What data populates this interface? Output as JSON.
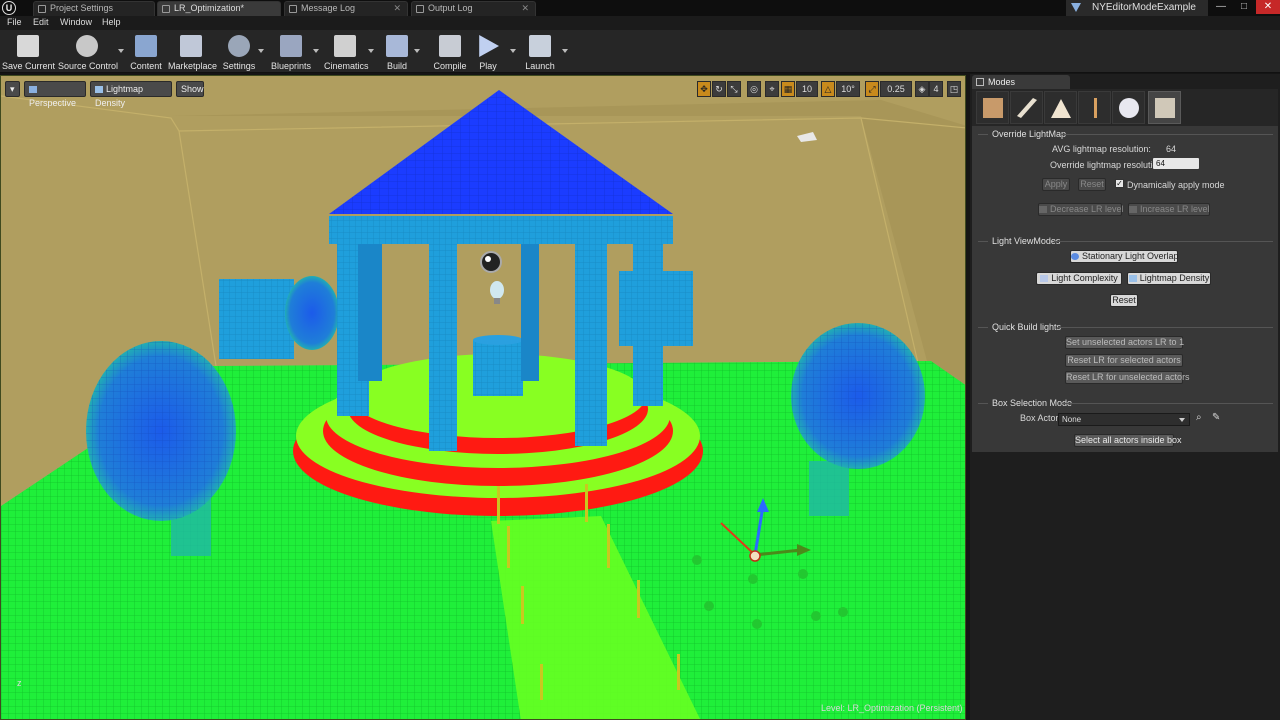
{
  "tabs": [
    {
      "label": "Project Settings"
    },
    {
      "label": "LR_Optimization*"
    },
    {
      "label": "Message Log"
    },
    {
      "label": "Output Log"
    }
  ],
  "project_name": "NYEditorModeExample",
  "menu": [
    "File",
    "Edit",
    "Window",
    "Help"
  ],
  "toolbar": {
    "save_current": "Save Current",
    "source_control": "Source Control",
    "content": "Content",
    "marketplace": "Marketplace",
    "settings": "Settings",
    "blueprints": "Blueprints",
    "cinematics": "Cinematics",
    "build": "Build",
    "compile": "Compile",
    "play": "Play",
    "launch": "Launch"
  },
  "viewport": {
    "perspective": "Perspective",
    "view_mode": "Lightmap Density",
    "show": "Show",
    "grid_snap": "10",
    "rotation_snap": "10°",
    "scale_snap": "0.25",
    "camera_speed": "4",
    "level": "Level:  LR_Optimization (Persistent)",
    "axis": "z"
  },
  "modes_panel": {
    "tab_title": "Modes",
    "override_section": "Override LightMap",
    "avg_label": "AVG lightmap resolution:",
    "avg_value": "64",
    "override_label": "Override lightmap resolution:",
    "override_value": "64",
    "apply": "Apply",
    "reset": "Reset",
    "dynamic_apply": "Dynamically apply mode",
    "dynamic_apply_checked": true,
    "decrease_lr": "Decrease LR level",
    "increase_lr": "Increase LR level",
    "viewmodes_section": "Light ViewModes",
    "stationary": "Stationary Light Overlap",
    "light_complexity": "Light Complexity",
    "lightmap_density": "Lightmap Density",
    "viewmode_reset": "Reset",
    "quick_build_section": "Quick Build lights",
    "set_unselected": "Set unselected actors LR to 1",
    "reset_selected": "Reset LR for selected actors",
    "reset_unselected": "Reset LR for unselected actors",
    "box_section": "Box Selection Mode",
    "box_actor_label": "Box Actor:",
    "box_actor_value": "None",
    "select_inside": "Select all actors inside box"
  },
  "colors": {
    "floor_green": "#1fef3a",
    "blue_dense": "#1b3cff",
    "light_blue": "#1f8fd0",
    "red_steps": "#ff1a12",
    "wall": "#b09e5f"
  }
}
